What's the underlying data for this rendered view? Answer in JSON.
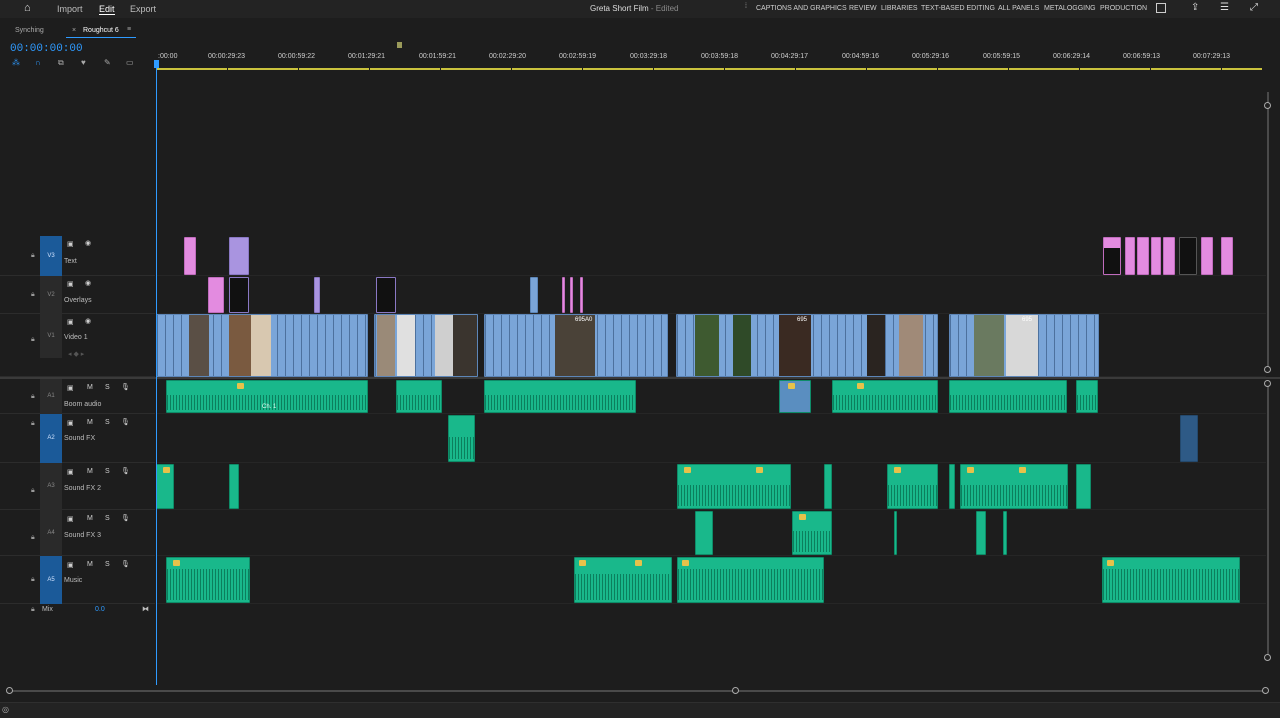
{
  "app": {
    "project_title": "Greta Short Film",
    "project_status": "- Edited"
  },
  "nav": {
    "import": "Import",
    "edit": "Edit",
    "export": "Export"
  },
  "workspaces": [
    "CAPTIONS AND GRAPHICS",
    "REVIEW",
    "LIBRARIES",
    "TEXT-BASED EDITING",
    "ALL PANELS",
    "METALOGGING",
    "PRODUCTION"
  ],
  "tabs": [
    {
      "label": "Synching"
    },
    {
      "label": "Roughcut 6",
      "active": true
    }
  ],
  "timecode": "00:00:00:00",
  "ruler_ticks": [
    ":00:00",
    "00:00:29:23",
    "00:00:59:22",
    "00:01:29:21",
    "00:01:59:21",
    "00:02:29:20",
    "00:02:59:19",
    "00:03:29:18",
    "00:03:59:18",
    "00:04:29:17",
    "00:04:59:16",
    "00:05:29:16",
    "00:05:59:15",
    "00:06:29:14",
    "00:06:59:13",
    "00:07:29:13"
  ],
  "tracks": {
    "video": [
      {
        "id": "V3",
        "name": "Text"
      },
      {
        "id": "V2",
        "name": "Overlays"
      },
      {
        "id": "V1",
        "name": "Video 1"
      }
    ],
    "audio": [
      {
        "id": "A1",
        "name": "Boom audio"
      },
      {
        "id": "A2",
        "name": "Sound FX"
      },
      {
        "id": "A3",
        "name": "Sound FX 2"
      },
      {
        "id": "A4",
        "name": "Sound FX 3"
      },
      {
        "id": "A5",
        "name": "Music"
      }
    ],
    "mix": {
      "label": "Mix",
      "value": "0.0"
    }
  },
  "clip_labels": {
    "v1_clip_a": "695A0",
    "v1_clip_b": "695",
    "v1_clip_c": "695",
    "channel_label": "Ch. 1"
  },
  "colors": {
    "accent": "#2f9bff",
    "video_clip": "#7aa5d8",
    "audio_clip": "#19b88b",
    "text_clip": "#e38be0",
    "overlay_clip": "#a994e0",
    "track_id": "#1b5a99"
  }
}
